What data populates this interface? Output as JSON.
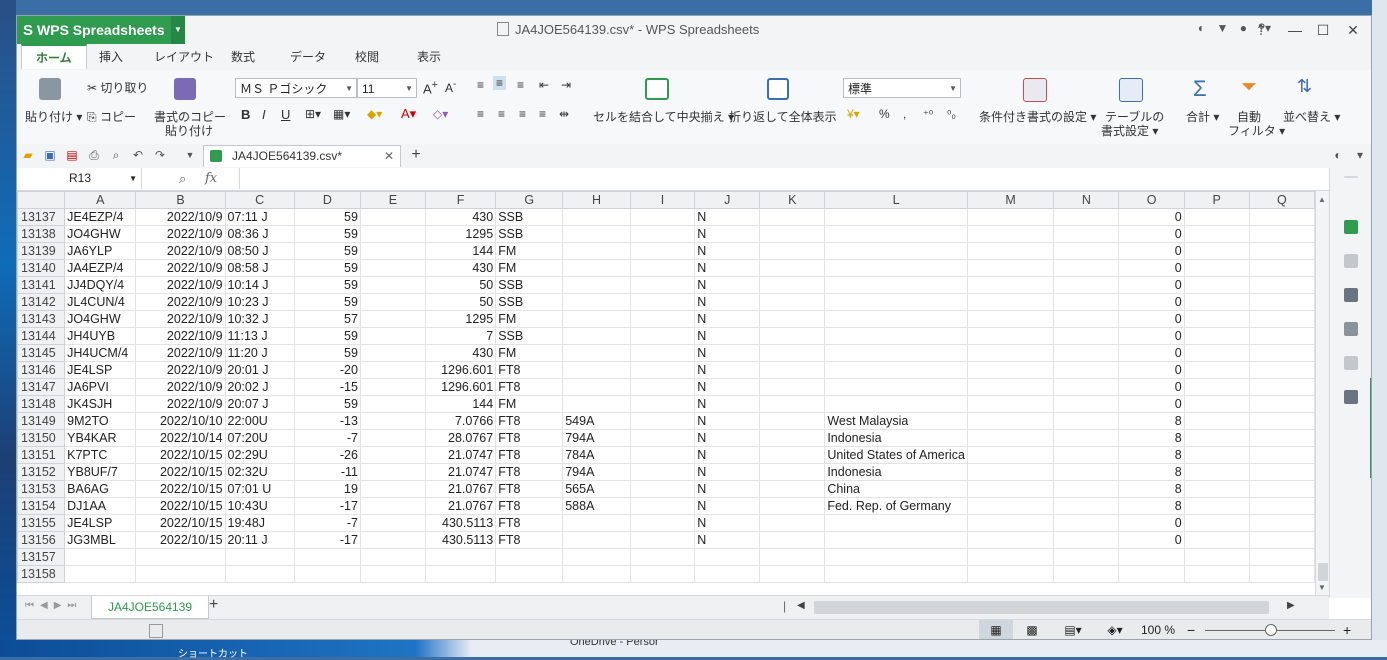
{
  "app": {
    "name": "WPS Spreadsheets",
    "title": "JA4JOE564139.csv* - WPS Spreadsheets"
  },
  "tabs": [
    "ホーム",
    "挿入",
    "レイアウト",
    "数式",
    "データ",
    "校閲",
    "表示"
  ],
  "ribbon": {
    "paste": "貼り付け",
    "cut": "切り取り",
    "copy": "コピー",
    "format_painter_1": "書式のコピー",
    "format_painter_2": "貼り付け",
    "font_name": "ＭＳ Ｐゴシック",
    "font_size": "11",
    "bold": "B",
    "italic": "I",
    "underline": "U",
    "merge_center": "セルを結合して中央揃え",
    "wrap_text": "折り返して全体表示",
    "number_format": "標準",
    "percent": "%",
    "comma": ",",
    "conditional_format": "条件付き書式の設定",
    "table_format_1": "テーブルの",
    "table_format_2": "書式設定",
    "sum": "合計",
    "autofilter_1": "自動",
    "autofilter_2": "フィルタ",
    "sort": "並べ替え"
  },
  "doc_tab": "JA4JOE564139.csv*",
  "name_box": "R13",
  "fx_label": "fx",
  "columns": [
    "A",
    "B",
    "C",
    "D",
    "E",
    "F",
    "G",
    "H",
    "I",
    "J",
    "K",
    "L",
    "M",
    "N",
    "O",
    "P",
    "Q"
  ],
  "rows": [
    {
      "n": "13137",
      "a": "JE4EZP/4",
      "b": "2022/10/9",
      "c": "07:11 J",
      "d": "59",
      "f": "430",
      "g": "SSB",
      "h": "",
      "j": "N",
      "l": "",
      "o": "0"
    },
    {
      "n": "13138",
      "a": "JO4GHW",
      "b": "2022/10/9",
      "c": "08:36 J",
      "d": "59",
      "f": "1295",
      "g": "SSB",
      "h": "",
      "j": "N",
      "l": "",
      "o": "0"
    },
    {
      "n": "13139",
      "a": "JA6YLP",
      "b": "2022/10/9",
      "c": "08:50 J",
      "d": "59",
      "f": "144",
      "g": "FM",
      "h": "",
      "j": "N",
      "l": "",
      "o": "0"
    },
    {
      "n": "13140",
      "a": "JA4EZP/4",
      "b": "2022/10/9",
      "c": "08:58 J",
      "d": "59",
      "f": "430",
      "g": "FM",
      "h": "",
      "j": "N",
      "l": "",
      "o": "0"
    },
    {
      "n": "13141",
      "a": "JJ4DQY/4",
      "b": "2022/10/9",
      "c": "10:14 J",
      "d": "59",
      "f": "50",
      "g": "SSB",
      "h": "",
      "j": "N",
      "l": "",
      "o": "0"
    },
    {
      "n": "13142",
      "a": "JL4CUN/4",
      "b": "2022/10/9",
      "c": "10:23 J",
      "d": "59",
      "f": "50",
      "g": "SSB",
      "h": "",
      "j": "N",
      "l": "",
      "o": "0"
    },
    {
      "n": "13143",
      "a": "JO4GHW",
      "b": "2022/10/9",
      "c": "10:32 J",
      "d": "57",
      "f": "1295",
      "g": "FM",
      "h": "",
      "j": "N",
      "l": "",
      "o": "0"
    },
    {
      "n": "13144",
      "a": "JH4UYB",
      "b": "2022/10/9",
      "c": "11:13 J",
      "d": "59",
      "f": "7",
      "g": "SSB",
      "h": "",
      "j": "N",
      "l": "",
      "o": "0"
    },
    {
      "n": "13145",
      "a": "JH4UCM/4",
      "b": "2022/10/9",
      "c": "11:20 J",
      "d": "59",
      "f": "430",
      "g": "FM",
      "h": "",
      "j": "N",
      "l": "",
      "o": "0"
    },
    {
      "n": "13146",
      "a": "JE4LSP",
      "b": "2022/10/9",
      "c": "20:01 J",
      "d": "-20",
      "f": "1296.601",
      "g": "FT8",
      "h": "",
      "j": "N",
      "l": "",
      "o": "0"
    },
    {
      "n": "13147",
      "a": "JA6PVI",
      "b": "2022/10/9",
      "c": "20:02 J",
      "d": "-15",
      "f": "1296.601",
      "g": "FT8",
      "h": "",
      "j": "N",
      "l": "",
      "o": "0"
    },
    {
      "n": "13148",
      "a": "JK4SJH",
      "b": "2022/10/9",
      "c": "20:07 J",
      "d": "59",
      "f": "144",
      "g": "FM",
      "h": "",
      "j": "N",
      "l": "",
      "o": "0"
    },
    {
      "n": "13149",
      "a": "9M2TO",
      "b": "2022/10/10",
      "c": "22:00U",
      "d": "-13",
      "f": "7.0766",
      "g": "FT8",
      "h": "549A",
      "j": "N",
      "l": "West Malaysia",
      "o": "8"
    },
    {
      "n": "13150",
      "a": "YB4KAR",
      "b": "2022/10/14",
      "c": "07:20U",
      "d": "-7",
      "f": "28.0767",
      "g": "FT8",
      "h": "794A",
      "j": "N",
      "l": "Indonesia",
      "o": "8"
    },
    {
      "n": "13151",
      "a": "K7PTC",
      "b": "2022/10/15",
      "c": "02:29U",
      "d": "-26",
      "f": "21.0747",
      "g": "FT8",
      "h": "784A",
      "j": "N",
      "l": "United States of America",
      "o": "8"
    },
    {
      "n": "13152",
      "a": "YB8UF/7",
      "b": "2022/10/15",
      "c": "02:32U",
      "d": "-11",
      "f": "21.0747",
      "g": "FT8",
      "h": "794A",
      "j": "N",
      "l": "Indonesia",
      "o": "8"
    },
    {
      "n": "13153",
      "a": "BA6AG",
      "b": "2022/10/15",
      "c": "07:01 U",
      "d": "19",
      "f": "21.0767",
      "g": "FT8",
      "h": "565A",
      "j": "N",
      "l": "China",
      "o": "8"
    },
    {
      "n": "13154",
      "a": "DJ1AA",
      "b": "2022/10/15",
      "c": "10:43U",
      "d": "-17",
      "f": "21.0767",
      "g": "FT8",
      "h": "588A",
      "j": "N",
      "l": "Fed. Rep. of Germany",
      "o": "8"
    },
    {
      "n": "13155",
      "a": "JE4LSP",
      "b": "2022/10/15",
      "c": "19:48J",
      "d": "-7",
      "f": "430.5113",
      "g": "FT8",
      "h": "",
      "j": "N",
      "l": "",
      "o": "0"
    },
    {
      "n": "13156",
      "a": "JG3MBL",
      "b": "2022/10/15",
      "c": "20:11 J",
      "d": "-17",
      "f": "430.5113",
      "g": "FT8",
      "h": "",
      "j": "N",
      "l": "",
      "o": "0"
    },
    {
      "n": "13157",
      "a": "",
      "b": "",
      "c": "",
      "d": "",
      "f": "",
      "g": "",
      "h": "",
      "j": "",
      "l": "",
      "o": ""
    },
    {
      "n": "13158",
      "a": "",
      "b": "",
      "c": "",
      "d": "",
      "f": "",
      "g": "",
      "h": "",
      "j": "",
      "l": "",
      "o": ""
    }
  ],
  "sheet_tab": "JA4JOE564139",
  "zoom": "100 %",
  "desktop": {
    "shortcut_label": "ショートカット",
    "onedrive_label": "OneDrive - Persor"
  }
}
